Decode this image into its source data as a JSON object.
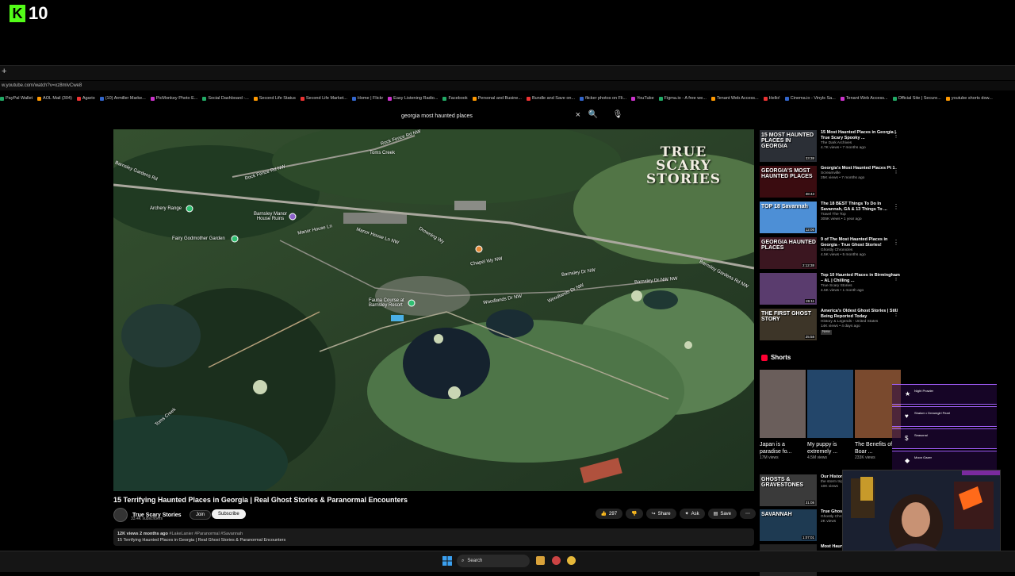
{
  "overlay": {
    "logo_letter": "K",
    "logo_number": "10"
  },
  "browser": {
    "new_tab": "+",
    "url": "w.youtube.com/watch?v=xz8mlvCwe8",
    "bookmarks": [
      "PayPal Wallet",
      "AOL Mail (304)",
      "Agario",
      "(10) Armiller Marke...",
      "PicMonkey Photo E...",
      "Social Dashboard -...",
      "Second Life Status",
      "Second Life Market...",
      "Home | Flickr",
      "Easy Listening Radio...",
      "Facebook",
      "Personal and Busine...",
      "Bundle and Save on...",
      "flicker photos on Fli...",
      "YouTube",
      "Figma.io - A free we...",
      "Tenant Web Access...",
      "Hello!",
      "Cinema.io - Vinyls Sa...",
      "Tenant Web Access...",
      "Official Site | Secure...",
      "youtube shorts dow..."
    ]
  },
  "youtube": {
    "search_query": "georgia most haunted places",
    "clear_icon": "×",
    "search_icon": "🔍",
    "mic_icon": "🎙",
    "video": {
      "watermark_line1": "TRUE SCARY",
      "watermark_line2": "STORIES",
      "map_labels": {
        "rock_fence_rd": "Rock Fence Rd NW",
        "rock_fence_rd2": "Rock Fence Rd NW",
        "toms_creek_top": "Toms Creek",
        "barnsley_garden_rd": "Barnsley Gardens Rd",
        "archery_range": "Archery Range",
        "manor_ruins": "Barnsley Manor House Ruins",
        "fairy_garden": "Fairy Godmother Garden",
        "manor_house_ln": "Manor House Ln",
        "manor_house_ln2": "Manor House Ln NW",
        "chapel_wy": "Chapel Wy NW",
        "drowning_wy": "Drowning Wy",
        "barnsley_dr": "Barnsley Dr NW",
        "barnsley_dr2": "Barnsley Dr NW NW",
        "barnsley_gardens_rd2": "Barnsley Gardens Rd NW",
        "fauna_course": "Fauna Course at Barnsley Resort",
        "woodlands_dr": "Woodlands Dr NW",
        "woodlands_dr2": "Woodlands Dr NW",
        "toms_creek_bottom": "Toms Creek"
      }
    },
    "title": "15 Terrifying Haunted Places in Georgia | Real Ghost Stories & Paranormal Encounters",
    "channel": {
      "name": "True Scary Stories",
      "subscribers": "33.4K subscribers",
      "join": "Join",
      "subscribe": "Subscribe"
    },
    "actions": {
      "likes": "297",
      "share": "Share",
      "ask": "Ask",
      "save": "Save",
      "more": "⋯"
    },
    "description": {
      "stats": "12K views  2 months ago",
      "tags": "#LakeLanier #Paranormal #Savannah",
      "text": "15 Terrifying Haunted Places in Georgia | Real Ghost Stories & Paranormal Encounters"
    },
    "recommendations": [
      {
        "thumb_text": "15 MOST HAUNTED PLACES IN GEORGIA",
        "title": "15 Most Haunted Places in Georgia | True Scary Spooky ...",
        "channel": "The Dark Archives",
        "stats": "4.7K views • 7 months ago",
        "duration": "23:38",
        "bg": "#2b2f36"
      },
      {
        "thumb_text": "GEORGIA'S MOST HAUNTED PLACES",
        "title": "Georgia's Most Haunted Places Pt 1",
        "channel": "Screamville",
        "stats": "25K views • 7 months ago",
        "duration": "38:43",
        "bg": "#3a0c10"
      },
      {
        "thumb_text": "TOP 18 Savannah",
        "title": "The 18 BEST Things To Do In Savannah, GA & 13 Things To ...",
        "channel": "Travel The Top",
        "stats": "305K views • 1 year ago",
        "duration": "12:06",
        "bg": "#4d8fd6"
      },
      {
        "thumb_text": "GEORGIA HAUNTED PLACES",
        "title": "9 of The Most Haunted Places in Georgia - True Ghost Stories!",
        "channel": "Ghostly Chronicles",
        "stats": "4.5K views • 5 months ago",
        "duration": "2:12:38",
        "bg": "#3b1620"
      },
      {
        "thumb_text": "",
        "title": "Top 10 Haunted Places in Birmingham – AL | Chilling ...",
        "channel": "True Scary Stories",
        "stats": "4.5K views • 1 month ago",
        "duration": "26:11",
        "bg": "#5a3c6e"
      },
      {
        "thumb_text": "THE FIRST GHOST STORY",
        "title": "America's Oldest Ghost Stories | Still Being Reported Today",
        "channel": "History & Legends - United States",
        "stats": "14K views • 4 days ago",
        "badge": "New",
        "duration": "25:58",
        "bg": "#3d3528"
      }
    ],
    "shorts_heading": "Shorts",
    "shorts": [
      {
        "title": "Japan is a paradise fo...",
        "views": "17M views",
        "bg": "#6a5e5b"
      },
      {
        "title": "My puppy is extremely ...",
        "views": "4.5M views",
        "bg": "#23466a"
      },
      {
        "title": "The Benefits of Boar ...",
        "views": "233K views",
        "bg": "#7a4a2e"
      }
    ],
    "more_recs": [
      {
        "thumb_text": "GHOSTS & GRAVESTONES",
        "title": "Our Historic ... town Trolley",
        "channel": "the storm trip",
        "stats": "10K views",
        "duration": "31:08",
        "bg": "#3a3a3a"
      },
      {
        "thumb_text": "SAVANNAH",
        "title": "True Ghost St... Savannah",
        "channel": "Ghostly Chronicles",
        "stats": "2K views",
        "duration": "1:07:01",
        "bg": "#1e3a52"
      },
      {
        "thumb_text": "",
        "title": "Most Haun...",
        "channel": "",
        "stats": "",
        "duration": "",
        "bg": "#222"
      }
    ]
  },
  "stream_overlay": {
    "chat_items": [
      {
        "icon": "★",
        "name": "Night Prowler"
      },
      {
        "icon": "♥",
        "name": "Shalom • Dreamgirl Pearl"
      },
      {
        "icon": "$",
        "name": "Seasonal"
      },
      {
        "icon": "◆",
        "name": "Moon Gazer"
      }
    ]
  },
  "taskbar": {
    "search_label": "Search"
  }
}
